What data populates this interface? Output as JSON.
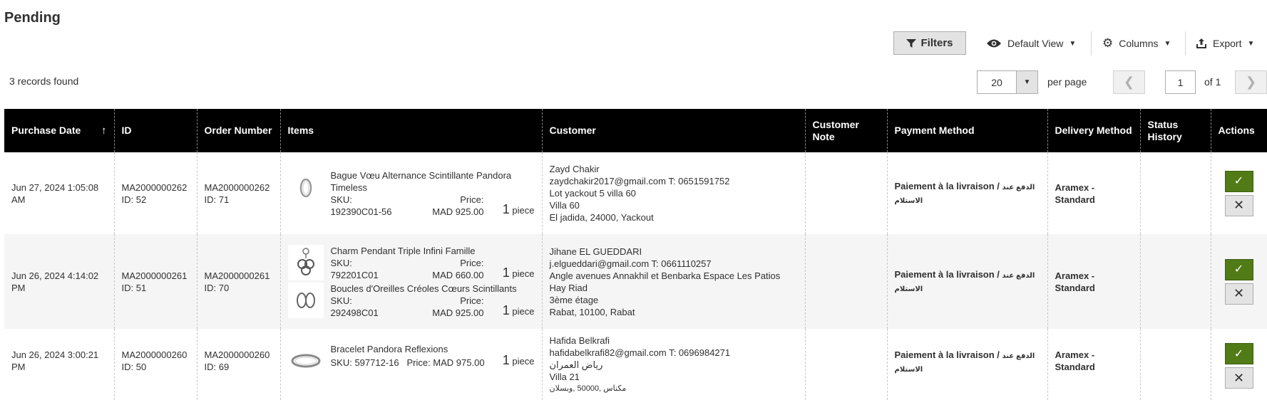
{
  "page": {
    "title": "Pending"
  },
  "toolbar": {
    "filters_label": "Filters",
    "view_label": "Default View",
    "columns_label": "Columns",
    "export_label": "Export"
  },
  "pager": {
    "records_text": "3 records found",
    "per_page_value": "20",
    "per_page_label": "per page",
    "current_page": "1",
    "of_label": "of 1"
  },
  "columns": [
    "Purchase Date",
    "ID",
    "Order Number",
    "Items",
    "Customer",
    "Customer Note",
    "Payment Method",
    "Delivery Method",
    "Status History",
    "Actions"
  ],
  "rows": [
    {
      "date": "Jun 27, 2024 1:05:08 AM",
      "id_code": "MA2000000262",
      "id_num": "ID: 52",
      "order_code": "MA2000000262",
      "order_id": "ID: 71",
      "items": [
        {
          "name": "Bague Vœu Alternance Scintillante Pandora Timeless",
          "sku_label": "SKU:",
          "sku": "192390C01-56",
          "price_label": "Price:",
          "price": "MAD 925.00",
          "qty": "1",
          "qty_unit": "piece",
          "icon": "ring-icon"
        }
      ],
      "customer": [
        "Zayd Chakir",
        "zaydchakir2017@gmail.com T: 0651591752",
        "Lot yackout 5 villa 60",
        "Villa 60",
        "El jadida, 24000, Yackout"
      ],
      "note": "",
      "payment": "Paiement à la livraison /",
      "payment_ar_1": "الدفع عند",
      "payment_ar_2": "الاستلام",
      "delivery": "Aramex - Standard"
    },
    {
      "date": "Jun 26, 2024 4:14:02 PM",
      "id_code": "MA2000000261",
      "id_num": "ID: 51",
      "order_code": "MA2000000261",
      "order_id": "ID: 70",
      "items": [
        {
          "name": "Charm Pendant Triple Infini Famille",
          "sku_label": "SKU:",
          "sku": "792201C01",
          "price_label": "Price:",
          "price": "MAD 660.00",
          "qty": "1",
          "qty_unit": "piece",
          "icon": "charm-pendant-icon"
        },
        {
          "name": "Boucles d'Oreilles Créoles Cœurs Scintillants",
          "sku_label": "SKU:",
          "sku": "292498C01",
          "price_label": "Price:",
          "price": "MAD 925.00",
          "qty": "1",
          "qty_unit": "piece",
          "icon": "earrings-icon"
        }
      ],
      "customer": [
        "Jihane EL GUEDDARI",
        "j.elgueddari@gmail.com T: 0661110257",
        "Angle avenues Annakhil et Benbarka Espace Les Patios",
        "Hay Riad",
        "3ème étage",
        "Rabat, 10100, Rabat"
      ],
      "note": "",
      "payment": "Paiement à la livraison /",
      "payment_ar_1": "الدفع عند",
      "payment_ar_2": "الاستلام",
      "delivery": "Aramex - Standard"
    },
    {
      "date": "Jun 26, 2024 3:00:21 PM",
      "id_code": "MA2000000260",
      "id_num": "ID: 50",
      "order_code": "MA2000000260",
      "order_id": "ID: 69",
      "items": [
        {
          "name": "Bracelet Pandora Reflexions",
          "sku_inline": "SKU: 597712-16",
          "price_inline": "Price: MAD 975.00",
          "qty": "1",
          "qty_unit": "piece",
          "icon": "bracelet-icon"
        }
      ],
      "customer": [
        "Hafida Belkrafi",
        "hafidabelkrafi82@gmail.com T: 0696984271",
        "رياض العمران",
        "Villa 21",
        "مكناس ,50000 ,وبسلان"
      ],
      "note": "",
      "payment": "Paiement à la livraison /",
      "payment_ar_1": "الدفع عند",
      "payment_ar_2": "الاستلام",
      "delivery": "Aramex - Standard"
    }
  ],
  "actions": {
    "approve_symbol": "✓",
    "cancel_symbol": "✕"
  }
}
